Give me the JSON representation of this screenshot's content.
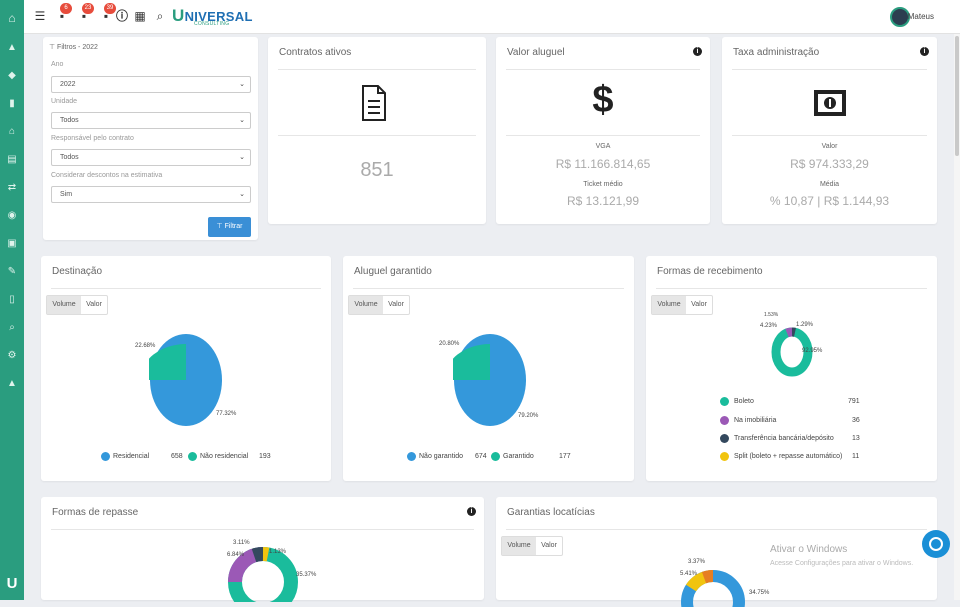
{
  "sidebar": {
    "items": [
      "home-icon",
      "alert-icon",
      "diamond-icon",
      "building-icon",
      "house-icon",
      "document-icon",
      "transfer-icon",
      "camera-icon",
      "money-icon",
      "tools-icon",
      "file-icon",
      "search-icon",
      "share-icon",
      "graduation-icon"
    ],
    "logo": "U"
  },
  "topbar": {
    "menu_icon": "☰",
    "badge_1": "6",
    "badge_2": "23",
    "badge_3": "39",
    "brand_initial": "U",
    "brand_rest": "NIVERSAL",
    "brand_sub": "CONSULTING",
    "user_name": "Mateus"
  },
  "filters": {
    "title": "Filtros - 2022",
    "ano_label": "Ano",
    "ano_value": "2022",
    "unidade_label": "Unidade",
    "unidade_value": "Todos",
    "responsavel_label": "Responsável pelo contrato",
    "responsavel_value": "Todos",
    "descontos_label": "Considerar descontos na estimativa",
    "descontos_value": "Sim",
    "button_label": "Filtrar"
  },
  "contratos": {
    "title": "Contratos ativos",
    "value": "851"
  },
  "aluguel": {
    "title": "Valor aluguel",
    "vga_label": "VGA",
    "vga_value": "R$ 11.166.814,65",
    "ticket_label": "Ticket médio",
    "ticket_value": "R$ 13.121,99"
  },
  "taxa": {
    "title": "Taxa administração",
    "valor_label": "Valor",
    "valor_value": "R$ 974.333,29",
    "media_label": "Média",
    "media_value": "% 10,87 | R$ 1.144,93"
  },
  "destinacao": {
    "title": "Destinação",
    "tab_volume": "Volume",
    "tab_valor": "Valor",
    "label_a": "22.68%",
    "label_b": "77.32%",
    "legend": [
      {
        "name": "Residencial",
        "value": "658",
        "color": "#3498db"
      },
      {
        "name": "Não residencial",
        "value": "193",
        "color": "#1abc9c"
      }
    ]
  },
  "garantido": {
    "title": "Aluguel garantido",
    "tab_volume": "Volume",
    "tab_valor": "Valor",
    "label_a": "20.80%",
    "label_b": "79.20%",
    "legend": [
      {
        "name": "Não garantido",
        "value": "674",
        "color": "#3498db"
      },
      {
        "name": "Garantido",
        "value": "177",
        "color": "#1abc9c"
      }
    ]
  },
  "recebimento": {
    "title": "Formas de recebimento",
    "tab_volume": "Volume",
    "tab_valor": "Valor",
    "label_top": "1.53%",
    "label_left": "4.23%",
    "label_right": "1.29%",
    "label_bottom": "92.95%",
    "legend": [
      {
        "name": "Boleto",
        "value": "791",
        "color": "#1abc9c"
      },
      {
        "name": "Na imobiliária",
        "value": "36",
        "color": "#9b59b6"
      },
      {
        "name": "Transferência bancária/depósito",
        "value": "13",
        "color": "#34495e"
      },
      {
        "name": "Split (boleto + repasse automático)",
        "value": "11",
        "color": "#f1c40f"
      }
    ]
  },
  "repasse": {
    "title": "Formas de repasse",
    "label_a": "3.11%",
    "label_b": "6.84%",
    "label_c": "1.13%",
    "label_d": "35.37%"
  },
  "garantias": {
    "title": "Garantias locatícias",
    "tab_volume": "Volume",
    "tab_valor": "Valor",
    "label_a": "3.37%",
    "label_b": "5.41%",
    "label_c": "34.75%"
  },
  "windows": {
    "line1": "Ativar o Windows",
    "line2": "Acesse Configurações para ativar o Windows."
  }
}
